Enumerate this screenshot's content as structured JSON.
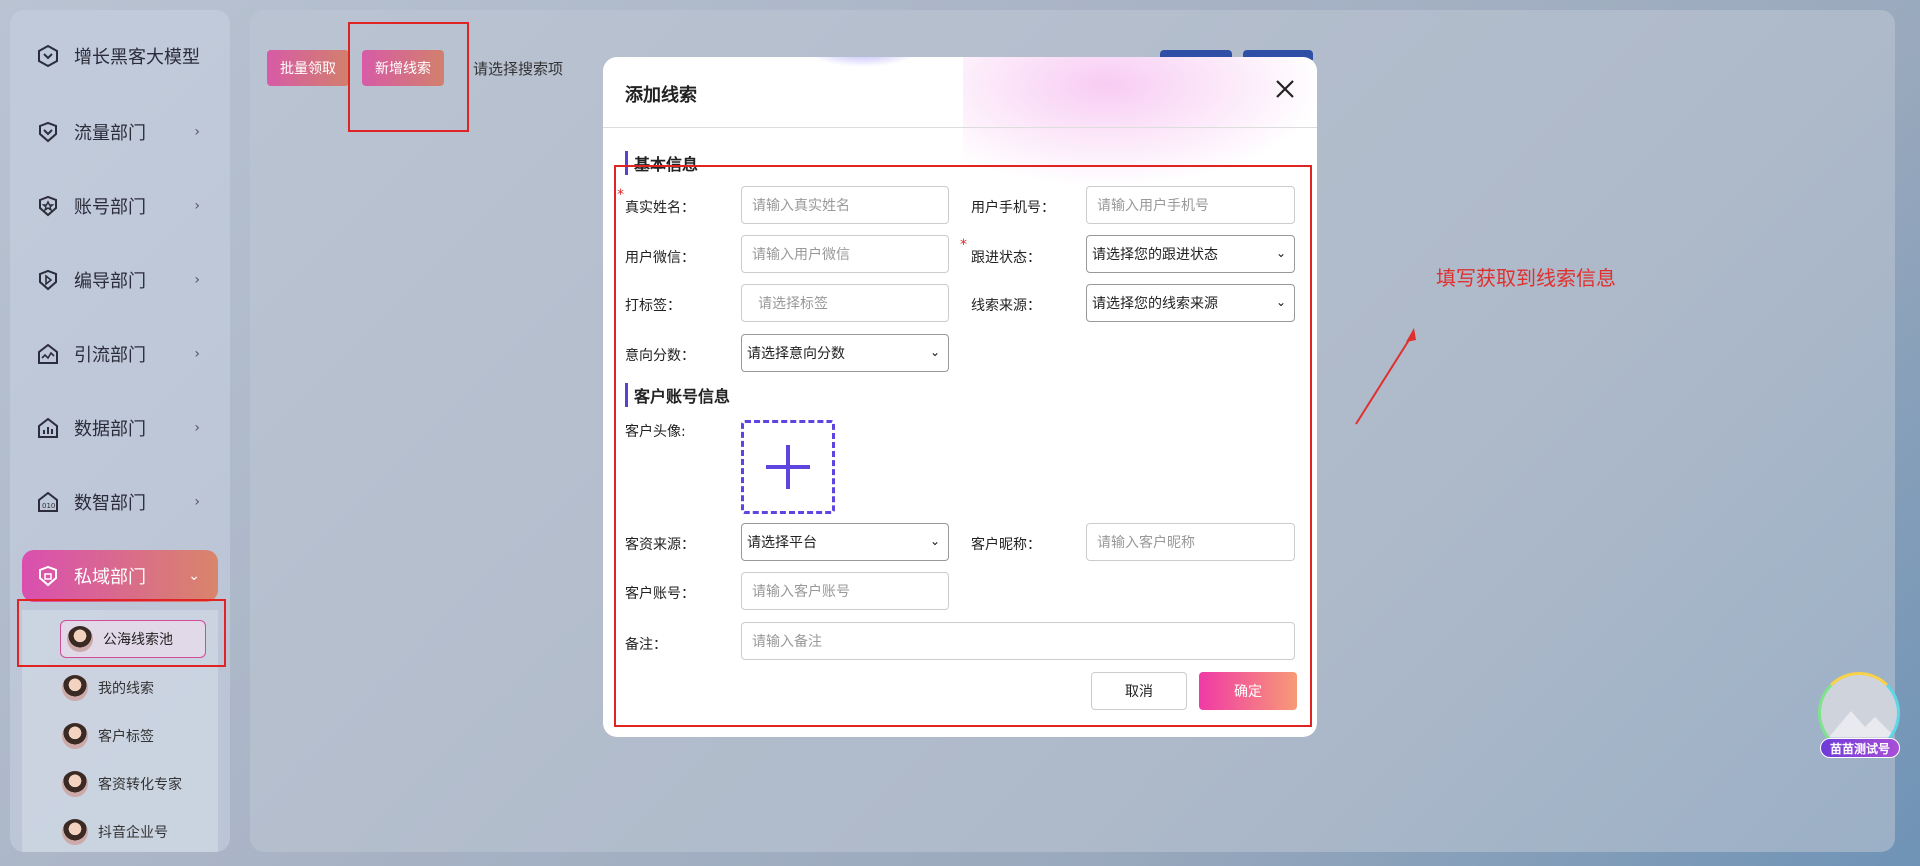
{
  "sidebar": {
    "brand": "增长黑客大模型",
    "items": [
      {
        "label": "流量部门",
        "icon": "funnel-icon"
      },
      {
        "label": "账号部门",
        "icon": "star-shield-icon"
      },
      {
        "label": "编导部门",
        "icon": "play-icon"
      },
      {
        "label": "引流部门",
        "icon": "chart-house-icon"
      },
      {
        "label": "数据部门",
        "icon": "bar-chart-icon"
      },
      {
        "label": "数智部门",
        "icon": "data-icon"
      },
      {
        "label": "私域部门",
        "icon": "shield-lock-icon",
        "active": true
      }
    ],
    "sub_items": [
      {
        "label": "公海线索池",
        "selected": true
      },
      {
        "label": "我的线索"
      },
      {
        "label": "客户标签"
      },
      {
        "label": "客资转化专家"
      },
      {
        "label": "抖音企业号"
      }
    ]
  },
  "toolbar": {
    "batch_claim": "批量领取",
    "add_lead": "新增线索",
    "search_placeholder": "请选择搜索项"
  },
  "modal": {
    "title": "添加线索",
    "section_basic": "基本信息",
    "section_account": "客户账号信息",
    "fields": {
      "real_name_label": "真实姓名：",
      "real_name_placeholder": "请输入真实姓名",
      "phone_label": "用户手机号：",
      "phone_placeholder": "请输入用户手机号",
      "wechat_label": "用户微信：",
      "wechat_placeholder": "请输入用户微信",
      "follow_status_label": "跟进状态：",
      "follow_status_value": "请选择您的跟进状态",
      "tag_label": "打标签：",
      "tag_placeholder": "请选择标签",
      "lead_source_label": "线索来源：",
      "lead_source_value": "请选择您的线索来源",
      "intent_score_label": "意向分数：",
      "intent_score_value": "请选择意向分数",
      "avatar_label": "客户头像:",
      "client_source_label": "客资来源：",
      "client_source_value": "请选择平台",
      "nickname_label": "客户昵称：",
      "nickname_placeholder": "请输入客户昵称",
      "account_label": "客户账号：",
      "account_placeholder": "请输入客户账号",
      "remark_label": "备注：",
      "remark_placeholder": "请输入备注"
    },
    "required_mark": "*",
    "cancel": "取消",
    "confirm": "确定"
  },
  "annotation": {
    "text": "填写获取到线索信息"
  },
  "floating_badge": "苗苗测试号",
  "colors": {
    "accent_gradient_start": "#d94fb0",
    "accent_gradient_end": "#d9856a",
    "highlight_red": "#e02424",
    "section_bar": "#5b3fd6"
  }
}
